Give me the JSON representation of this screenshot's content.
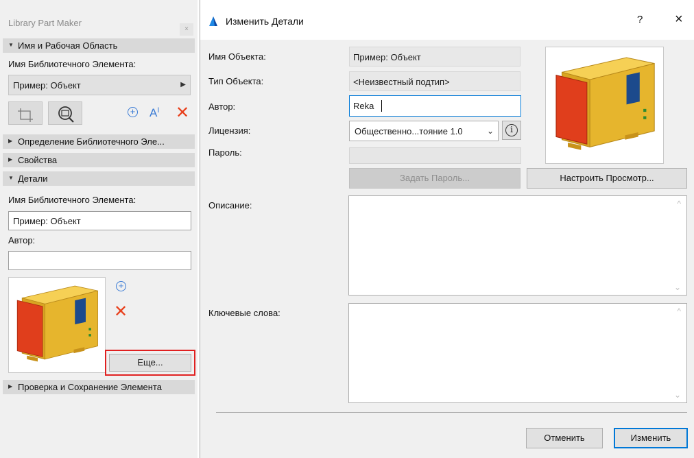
{
  "palette": {
    "title": "Library Part Maker",
    "close_glyph": "×",
    "sections": [
      {
        "label": "Имя и Рабочая Область",
        "expanded": true
      },
      {
        "label": "Определение Библиотечного Эле...",
        "expanded": false
      },
      {
        "label": "Свойства",
        "expanded": false
      },
      {
        "label": "Детали",
        "expanded": true
      },
      {
        "label": "Проверка и Сохранение Элемента",
        "expanded": false
      }
    ],
    "name_area": {
      "label": "Имя Библиотечного Элемента:",
      "selected": "Пример: Объект"
    },
    "details": {
      "name_label": "Имя Библиотечного Элемента:",
      "name_value": "Пример: Объект",
      "author_label": "Автор:",
      "author_value": "",
      "more_button": "Еще..."
    },
    "icons": {
      "crop": "crop-icon",
      "zoom": "zoom-fit-icon",
      "add": "add-circle-icon",
      "text": "text-cursor-icon",
      "delete": "delete-x-icon"
    }
  },
  "dialog": {
    "title": "Изменить Детали",
    "help": "?",
    "close": "×",
    "fields": {
      "object_name_label": "Имя Объекта:",
      "object_name_value": "Пример: Объект",
      "object_type_label": "Тип Объекта:",
      "object_type_value": "<Неизвестный подтип>",
      "author_label": "Автор:",
      "author_value": "Reka",
      "license_label": "Лицензия:",
      "license_value": "Общественно...тояние 1.0",
      "password_label": "Пароль:",
      "password_value": "",
      "description_label": "Описание:",
      "keywords_label": "Ключевые слова:"
    },
    "buttons": {
      "set_password": "Задать Пароль...",
      "configure_preview": "Настроить Просмотр...",
      "cancel": "Отменить",
      "apply": "Изменить"
    }
  },
  "colors": {
    "accent_blue": "#0078d7",
    "delete_red": "#e8401c",
    "highlight_red": "#e02020",
    "unit_body": "#e8b930",
    "unit_panel": "#e03e1c",
    "unit_grille": "#1c4a8c"
  }
}
